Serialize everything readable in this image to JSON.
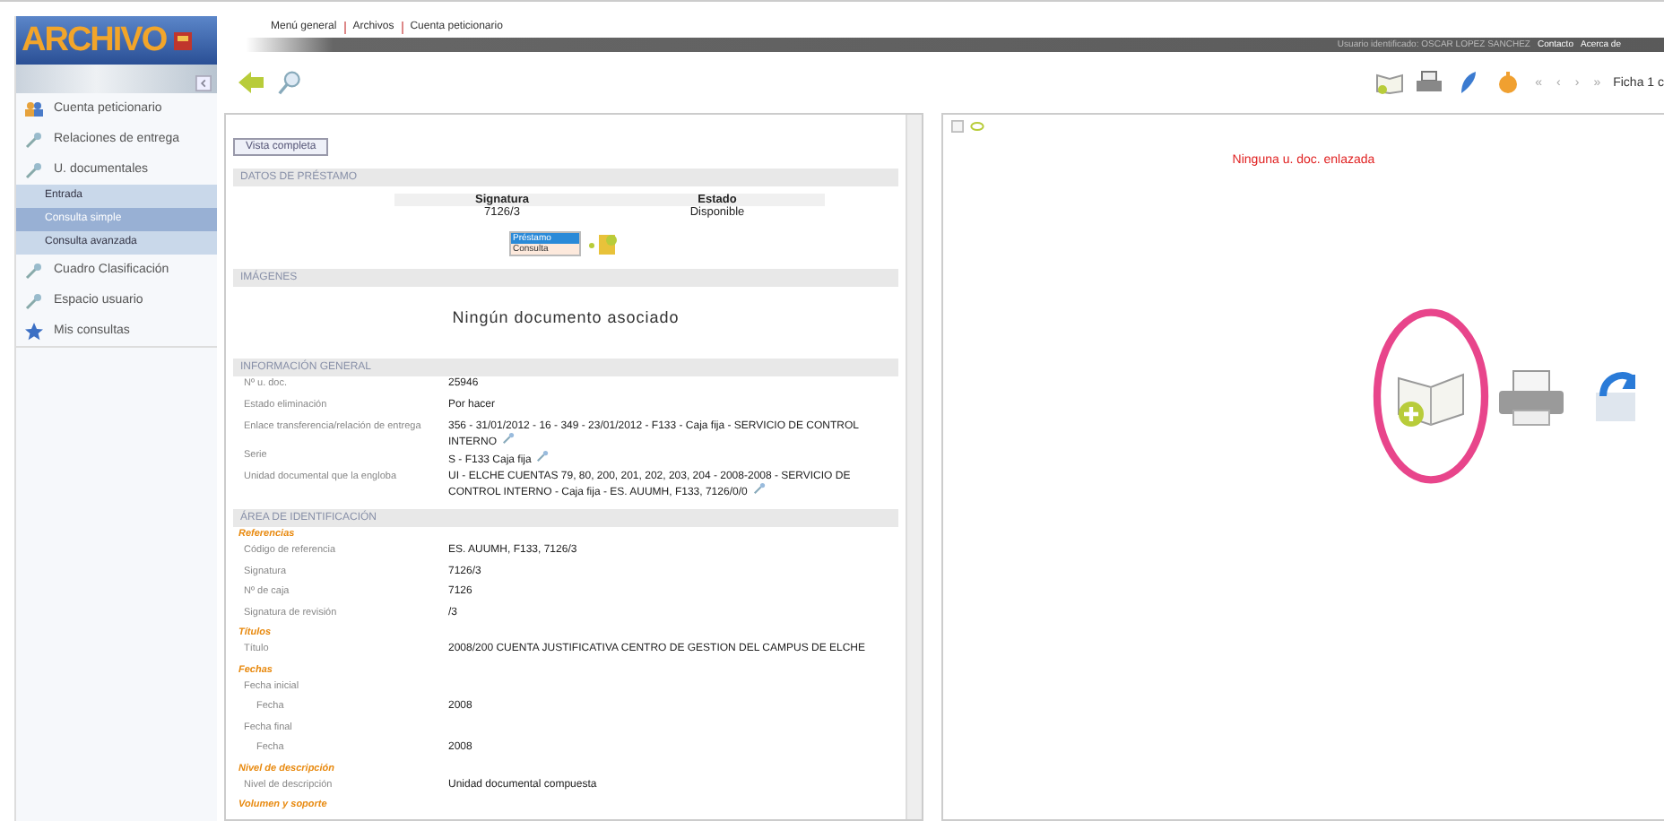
{
  "logo": {
    "title": "ARCHIVO"
  },
  "breadcrumb": [
    "Menú general",
    "Archivos",
    "Cuenta peticionario"
  ],
  "user_bar": {
    "user": "Usuario identificado: OSCAR LOPEZ SANCHEZ",
    "links": [
      "Contacto",
      "Acerca de"
    ]
  },
  "sidebar": {
    "items": [
      {
        "label": "Cuenta peticionario",
        "kind": "people"
      },
      {
        "label": "Relaciones de entrega",
        "kind": "pin"
      },
      {
        "label": "U. documentales",
        "kind": "pin",
        "children": [
          {
            "label": "Entrada",
            "selected": false
          },
          {
            "label": "Consulta simple",
            "selected": true
          },
          {
            "label": "Consulta avanzada",
            "selected": false
          }
        ]
      },
      {
        "label": "Cuadro Clasificación",
        "kind": "pin"
      },
      {
        "label": "Espacio usuario",
        "kind": "pin"
      },
      {
        "label": "Mis consultas",
        "kind": "star"
      }
    ]
  },
  "pager": {
    "buttons": [
      "«",
      "‹",
      "›",
      "»"
    ],
    "label": "Ficha 1 c"
  },
  "detail": {
    "view_button": "Vista completa",
    "loan": {
      "title": "DATOS DE PRÉSTAMO",
      "columns": [
        "Signatura",
        "Estado"
      ],
      "row": [
        "7126/3",
        "Disponible"
      ],
      "options": [
        {
          "label": "Préstamo",
          "selected": true
        },
        {
          "label": "Consulta",
          "selected": false
        }
      ]
    },
    "images": {
      "title": "IMÁGENES",
      "message": "Ningún documento asociado"
    },
    "general": {
      "title": "INFORMACIÓN GENERAL",
      "rows": [
        {
          "label": "Nº u. doc.",
          "value": "25946",
          "link": false
        },
        {
          "label": "Estado eliminación",
          "value": "Por hacer",
          "link": false
        },
        {
          "label": "Enlace transferencia/relación de entrega",
          "value": "356 - 31/01/2012 - 16 - 349 - 23/01/2012 - F133 - Caja fija - SERVICIO DE CONTROL INTERNO",
          "link": true
        },
        {
          "label": "Serie",
          "value": "S - F133 Caja fija",
          "link": true
        },
        {
          "label": "Unidad documental que la engloba",
          "value": "UI - ELCHE CUENTAS 79, 80, 200, 201, 202, 203, 204 - 2008-2008 - SERVICIO DE CONTROL INTERNO - Caja fija - ES. AUUMH, F133, 7126/0/0",
          "link": true
        }
      ]
    },
    "identification": {
      "title": "ÁREA DE IDENTIFICACIÓN",
      "groups": [
        {
          "label": "Referencias",
          "children": [
            {
              "label": "Código de referencia",
              "value": "ES. AUUMH, F133, 7126/3"
            },
            {
              "label": "Signatura",
              "value": "7126/3"
            },
            {
              "label": "Nº de caja",
              "value": "7126"
            },
            {
              "label": "Signatura de revisión",
              "value": "/3"
            }
          ]
        },
        {
          "label": "Títulos",
          "children": [
            {
              "label": "Título",
              "value": "2008/200 CUENTA JUSTIFICATIVA CENTRO DE GESTION DEL CAMPUS DE ELCHE"
            }
          ]
        },
        {
          "label": "Fechas",
          "children": [
            {
              "label": "Fecha inicial",
              "children": [
                {
                  "label": "Fecha",
                  "value": "2008"
                }
              ]
            },
            {
              "label": "Fecha final",
              "children": [
                {
                  "label": "Fecha",
                  "value": "2008"
                }
              ]
            }
          ]
        },
        {
          "label": "Nivel de descripción",
          "children": [
            {
              "label": "Nivel de descripción",
              "value": "Unidad documental compuesta"
            }
          ]
        },
        {
          "label": "Volumen y soporte"
        }
      ]
    }
  },
  "linked": {
    "message": "Ninguna u. doc. enlazada"
  }
}
